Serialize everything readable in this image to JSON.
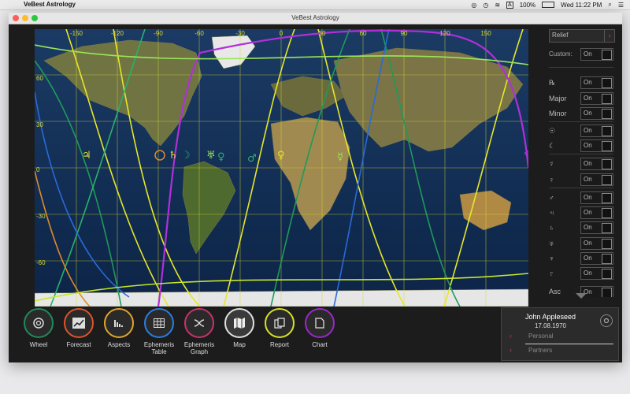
{
  "menubar": {
    "app_name": "VeBest Astrology",
    "battery": "100%",
    "input_source": "A",
    "datetime": "Wed 11:22 PM"
  },
  "window": {
    "title": "VeBest Astrology"
  },
  "map": {
    "longitude_ticks": [
      "-150",
      "-120",
      "-90",
      "-60",
      "-30",
      "0",
      "30",
      "60",
      "90",
      "120",
      "150"
    ],
    "latitude_ticks": [
      "60",
      "30",
      "0",
      "-30",
      "-60"
    ],
    "planet_glyphs": [
      "♃",
      "☉",
      "♄",
      "☽",
      "♅",
      "♀",
      "♂",
      "♀",
      "☿",
      "♆"
    ]
  },
  "sidebar": {
    "relief_select": "Relief",
    "custom_label": "Custom:",
    "toggle_on": "On",
    "rows": [
      "℞",
      "Major",
      "Minor",
      "☉",
      "☾",
      "☿",
      "♀",
      "♂",
      "♃",
      "♄",
      "♅",
      "♆",
      "♇",
      "Asc"
    ]
  },
  "toolbar": {
    "items": [
      "Wheel",
      "Forecast",
      "Aspects",
      "Ephemeris Table",
      "Ephemeris Graph",
      "Map",
      "Report",
      "Chart"
    ]
  },
  "profile": {
    "name": "John Appleseed",
    "date": "17.08.1970",
    "tabs": [
      "Personal",
      "Partners"
    ]
  },
  "colors": {
    "wheel": "#1f8a5a",
    "forecast": "#e0522a",
    "aspects": "#e0a52a",
    "ephemeris_table": "#2a7de0",
    "ephemeris_graph": "#c8326c",
    "map": "#e0e0e0",
    "report": "#d8e028",
    "chart": "#9a28c8",
    "accent": "#d6306b"
  }
}
